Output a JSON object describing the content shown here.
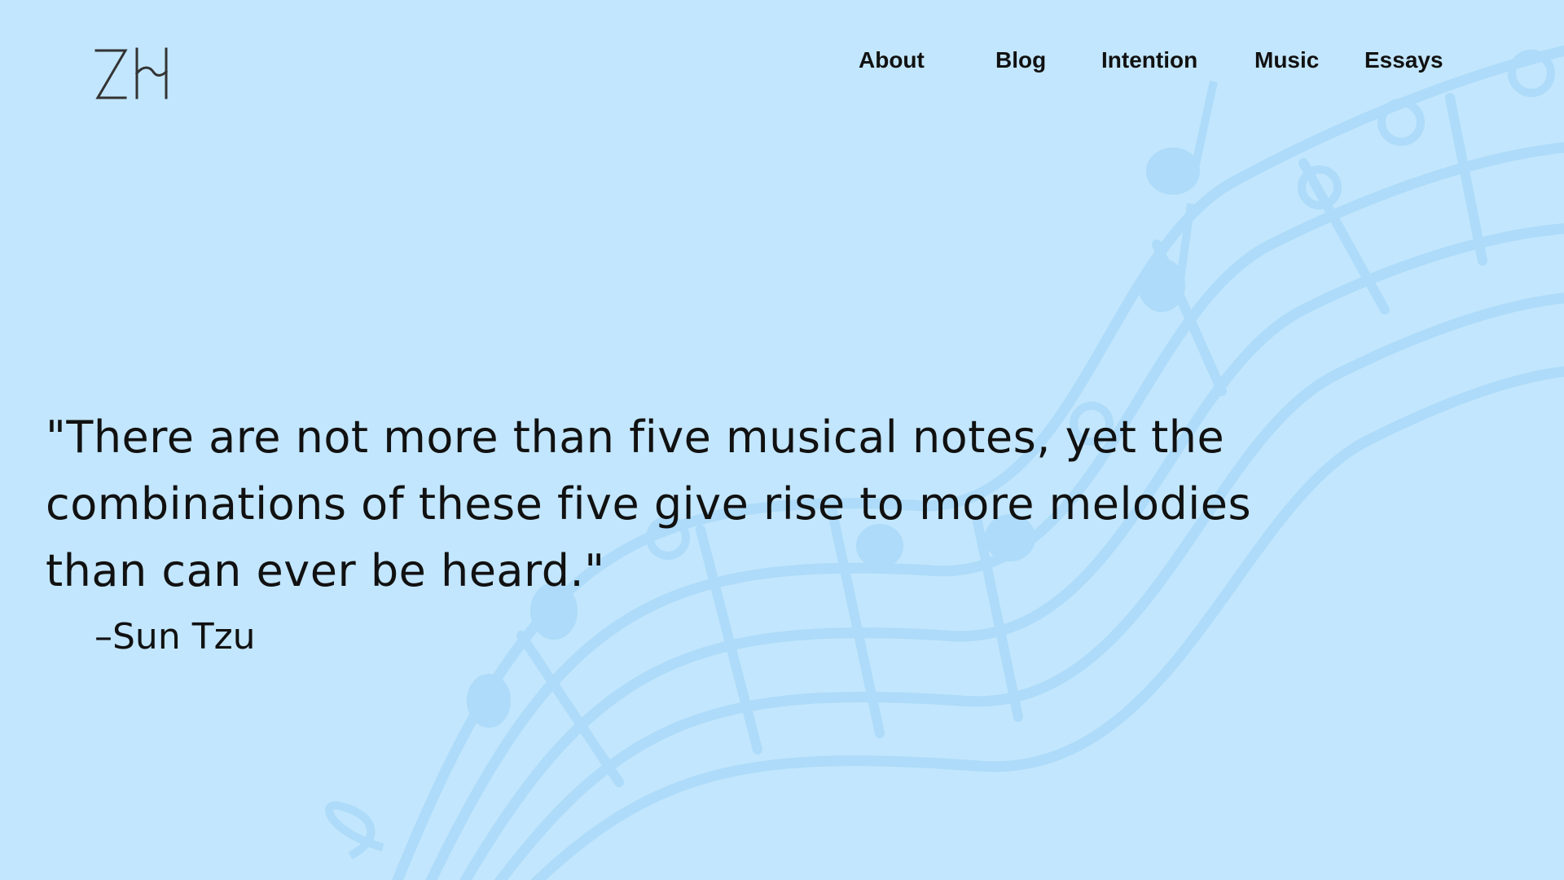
{
  "logo": {
    "text": "ZH",
    "icon": "zh-monogram-logo"
  },
  "nav": {
    "items": [
      {
        "label": "About"
      },
      {
        "label": "Blog"
      },
      {
        "label": "Intention"
      },
      {
        "label": "Music"
      },
      {
        "label": "Essays"
      }
    ]
  },
  "hero": {
    "quote": "\"There are not more than five musical notes, yet the combinations of these five give rise to more melodies than can ever be heard.\"",
    "attribution": "–Sun Tzu"
  },
  "background": {
    "icon": "music-staff-illustration",
    "color": "#c2e6fd",
    "illustration_color": "#addbf9"
  },
  "colors": {
    "text": "#111111",
    "logo": "#333333"
  }
}
